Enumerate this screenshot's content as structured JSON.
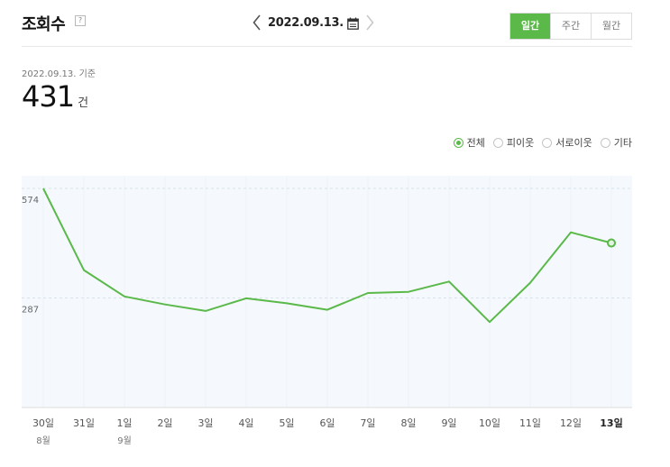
{
  "header": {
    "title": "조회수",
    "help": "?",
    "date": "2022.09.13.",
    "tabs": [
      {
        "label": "일간",
        "active": true
      },
      {
        "label": "주간",
        "active": false
      },
      {
        "label": "월간",
        "active": false
      }
    ]
  },
  "summary": {
    "ref_date": "2022.09.13. 기준",
    "value": "431",
    "unit": "건"
  },
  "legend": [
    {
      "label": "전체",
      "checked": true
    },
    {
      "label": "피이웃",
      "checked": false
    },
    {
      "label": "서로이웃",
      "checked": false
    },
    {
      "label": "기타",
      "checked": false
    }
  ],
  "colors": {
    "accent": "#5ab949",
    "plot_bg": "#f5f9fd",
    "grid": "#d8e2ec"
  },
  "chart_data": {
    "type": "line",
    "categories": [
      "30일",
      "31일",
      "1일",
      "2일",
      "3일",
      "4일",
      "5일",
      "6일",
      "7일",
      "8일",
      "9일",
      "10일",
      "11일",
      "12일",
      "13일"
    ],
    "month_labels": [
      "8월",
      "",
      "9월",
      "",
      "",
      "",
      "",
      "",
      "",
      "",
      "",
      "",
      "",
      "",
      ""
    ],
    "series": [
      {
        "values": [
          574,
          360,
          291,
          270,
          253,
          286,
          273,
          256,
          300,
          303,
          330,
          224,
          327,
          459,
          431
        ]
      }
    ],
    "ylim": [
      0,
      574
    ],
    "yticks": [
      574,
      287
    ],
    "highlight_last": true,
    "grid": true
  }
}
